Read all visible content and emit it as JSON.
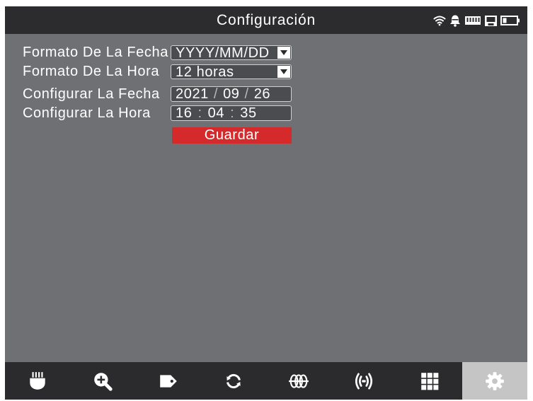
{
  "header": {
    "title": "Configuración",
    "status_icons": [
      "wifi-icon",
      "bell-icon",
      "memory-card-icon",
      "save-icon",
      "battery-icon"
    ]
  },
  "settings": {
    "date_format": {
      "label": "Formato De La Fecha",
      "value": "YYYY/MM/DD"
    },
    "time_format": {
      "label": "Formato De La Hora",
      "value": "12 horas"
    },
    "set_date": {
      "label": "Configurar La Fecha",
      "year": "2021",
      "month": "09",
      "day": "26",
      "separator": "/"
    },
    "set_time": {
      "label": "Configurar La Hora",
      "hour": "16",
      "minute": "04",
      "second": "35",
      "separator": ":"
    },
    "save_label": "Guardar"
  },
  "toolbar": {
    "items": [
      {
        "icon": "probe-icon"
      },
      {
        "icon": "zoom-in-icon"
      },
      {
        "icon": "tag-icon"
      },
      {
        "icon": "refresh-icon"
      },
      {
        "icon": "coil-icon"
      },
      {
        "icon": "signal-icon"
      },
      {
        "icon": "grid-icon"
      },
      {
        "icon": "gear-icon"
      }
    ],
    "active_index": 7
  },
  "colors": {
    "titlebar": "#2c2c2e",
    "background": "#6e7074",
    "field": "#4b4c50",
    "field-border": "#d0d0d0",
    "save": "#d42a2b",
    "toolbar": "#2b2b2d",
    "toolbar-active": "#c5c5c5"
  }
}
